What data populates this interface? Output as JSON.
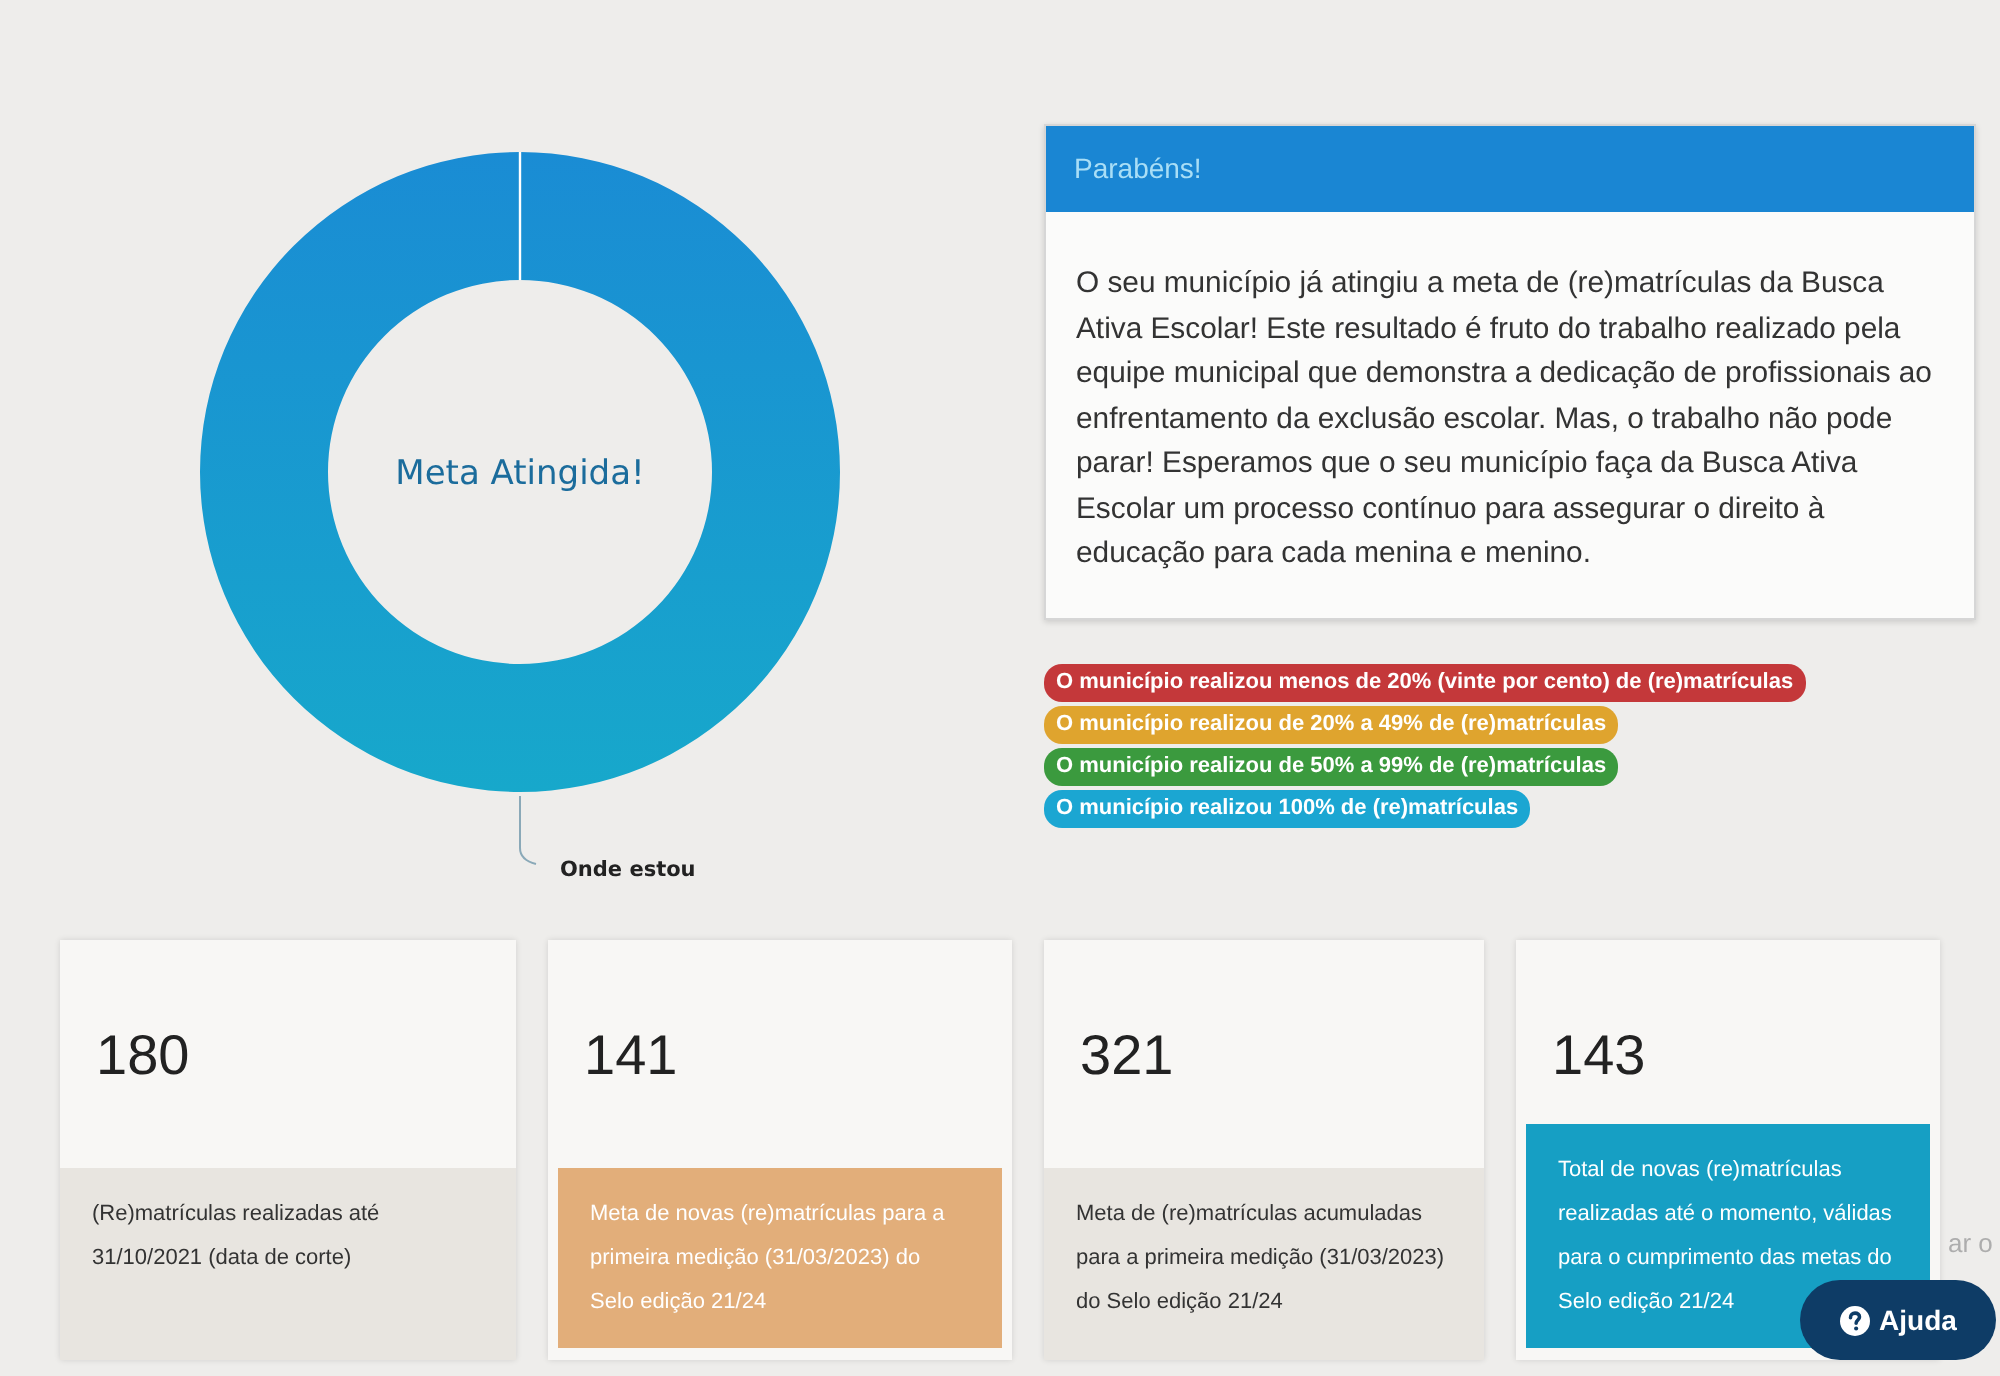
{
  "donut": {
    "center_label": "Meta Atingida!",
    "slice_label": "Onde estou"
  },
  "message_panel": {
    "title": "Parabéns!",
    "text": "O seu município já atingiu a meta de (re)matrículas da Busca Ativa Escolar! Este resultado é fruto do trabalho realizado pela equipe municipal que demonstra a dedicação de profissionais ao enfrentamento da exclusão escolar. Mas, o trabalho não pode parar! Esperamos que o seu município faça da Busca Ativa Escolar um processo contínuo para assegurar o direito à educação para cada menina e menino."
  },
  "legend": [
    {
      "label": "O município realizou menos de 20% (vinte por cento) de (re)matrículas",
      "color": "#c4383a"
    },
    {
      "label": "O município realizou de 20% a 49% de (re)matrículas",
      "color": "#dfa42e"
    },
    {
      "label": "O município realizou de 50% a 99% de (re)matrículas",
      "color": "#3b9a3e"
    },
    {
      "label": "O município realizou 100% de (re)matrículas",
      "color": "#1ba6d2"
    }
  ],
  "cards": [
    {
      "value": "180",
      "description": "(Re)matrículas realizadas até 31/10/2021 (data de corte)",
      "kind": "plain",
      "color": "#e8e5e0"
    },
    {
      "value": "141",
      "description": "Meta de novas (re)matrículas para a primeira medição (31/03/2023) do Selo edição 21/24",
      "kind": "filled",
      "color": "#e2ae7a"
    },
    {
      "value": "321",
      "description": "Meta de (re)matrículas acumuladas para a primeira medição (31/03/2023) do Selo edição 21/24",
      "kind": "plain",
      "color": "#e8e5e0"
    },
    {
      "value": "143",
      "description": "Total de novas (re)matrículas realizadas até o momento, válidas para o cumprimento das metas do Selo edição 21/24",
      "kind": "filled",
      "color": "#169fc4"
    }
  ],
  "partial_text": "ar o",
  "help_button": {
    "label": "Ajuda"
  }
}
